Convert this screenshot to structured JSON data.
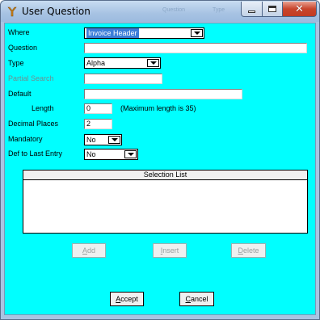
{
  "window": {
    "title": "User Question",
    "ghost_title_left": "Question",
    "ghost_title_right": "Type",
    "icons": {
      "app": "app-logo-icon",
      "minimize": "minimize-icon",
      "maximize": "maximize-icon",
      "close": "close-icon"
    }
  },
  "form": {
    "where": {
      "label": "Where",
      "value": "Invoice Header"
    },
    "question": {
      "label": "Question",
      "value": ""
    },
    "type": {
      "label": "Type",
      "value": "Alpha"
    },
    "partial_search": {
      "label": "Partial Search",
      "value": ""
    },
    "default": {
      "label": "Default",
      "value": ""
    },
    "length": {
      "label": "Length",
      "value": "0",
      "hint": "(Maximum length is 35)"
    },
    "decimal_places": {
      "label": "Decimal Places",
      "value": "2"
    },
    "mandatory": {
      "label": "Mandatory",
      "value": "No"
    },
    "def_to_last_entry": {
      "label": "Def to Last Entry",
      "value": "No"
    }
  },
  "selection_list": {
    "header": "Selection List",
    "items": []
  },
  "buttons": {
    "add": {
      "pre": "",
      "accel": "A",
      "post": "dd"
    },
    "insert": {
      "pre": "",
      "accel": "I",
      "post": "nsert"
    },
    "delete": {
      "pre": "",
      "accel": "D",
      "post": "elete"
    },
    "accept": {
      "pre": "",
      "accel": "A",
      "post": "ccept"
    },
    "cancel": {
      "pre": "",
      "accel": "C",
      "post": "ancel"
    }
  },
  "colors": {
    "client_background": "#00ffff",
    "selection_highlight": "#3b7dd8",
    "close_button": "#c8452c"
  }
}
